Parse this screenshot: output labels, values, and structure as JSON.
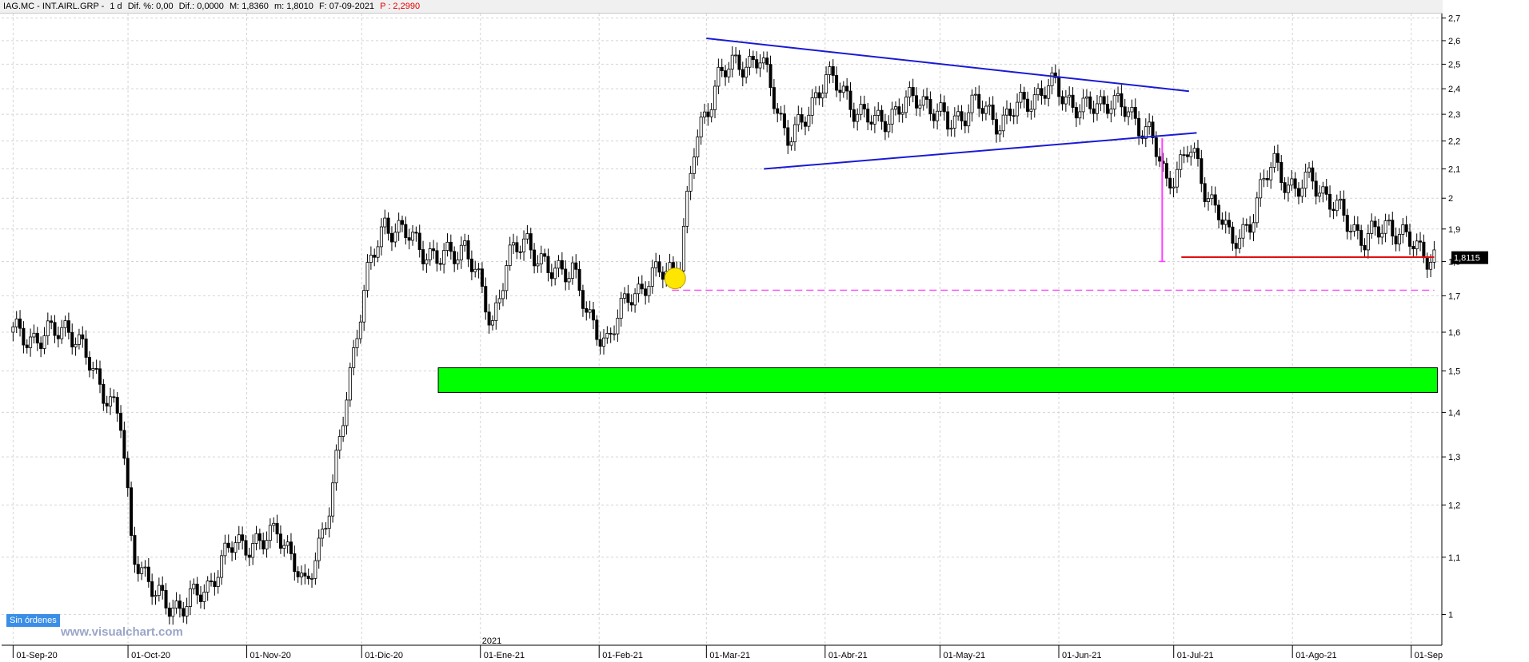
{
  "header": {
    "symbol": "IAG.MC - INT.AIRL.GRP -",
    "period": "1 d",
    "dif_pct": "Dif. %: 0,00",
    "dif": "Dif.: 0,0000",
    "max": "M: 1,8360",
    "min": "m: 1,8010",
    "date": "F: 07-09-2021",
    "p_value": "P : 2,2990"
  },
  "orders_badge": "Sin órdenes",
  "watermark": "www.visualchart.com",
  "colors": {
    "trendline": "#1a1ad4",
    "support": "#e01010",
    "zone": "#00ff00",
    "dashed": "#ff40ff",
    "marker": "#ffe600",
    "last_price_bg": "#000000"
  },
  "chart_data": {
    "type": "candlestick",
    "scale": "log",
    "ylim": [
      0.95,
      2.72
    ],
    "y_ticks": [
      "2,7",
      "2,6",
      "2,5",
      "2,4",
      "2,3",
      "2,2",
      "2,1",
      "2",
      "1,9",
      "1,8",
      "1,7",
      "1,6",
      "1,5",
      "1,4",
      "1,3",
      "1,2",
      "1,1",
      "1"
    ],
    "x_ticks": [
      "01-Sep-20",
      "01-Oct-20",
      "01-Nov-20",
      "01-Dic-20",
      "01-Ene-21",
      "01-Feb-21",
      "01-Mar-21",
      "01-Abr-21",
      "01-May-21",
      "01-Jun-21",
      "01-Jul-21",
      "01-Ago-21",
      "01-Sep"
    ],
    "year_label": "2021",
    "last_price": "1,8115",
    "close_path": [
      [
        "2020-09-01",
        1.6
      ],
      [
        "2020-09-08",
        1.58
      ],
      [
        "2020-09-15",
        1.62
      ],
      [
        "2020-09-22",
        1.5
      ],
      [
        "2020-09-29",
        1.38
      ],
      [
        "2020-10-02",
        1.12
      ],
      [
        "2020-10-08",
        1.03
      ],
      [
        "2020-10-15",
        1.01
      ],
      [
        "2020-10-22",
        1.05
      ],
      [
        "2020-10-29",
        1.13
      ],
      [
        "2020-11-05",
        1.12
      ],
      [
        "2020-11-09",
        1.16
      ],
      [
        "2020-11-16",
        1.04
      ],
      [
        "2020-11-23",
        1.2
      ],
      [
        "2020-11-30",
        1.62
      ],
      [
        "2020-12-03",
        1.78
      ],
      [
        "2020-12-07",
        1.92
      ],
      [
        "2020-12-14",
        1.87
      ],
      [
        "2020-12-21",
        1.8
      ],
      [
        "2020-12-28",
        1.85
      ],
      [
        "2021-01-04",
        1.62
      ],
      [
        "2021-01-08",
        1.8
      ],
      [
        "2021-01-13",
        1.87
      ],
      [
        "2021-01-19",
        1.76
      ],
      [
        "2021-01-25",
        1.79
      ],
      [
        "2021-01-29",
        1.63
      ],
      [
        "2021-02-03",
        1.58
      ],
      [
        "2021-02-09",
        1.7
      ],
      [
        "2021-02-16",
        1.76
      ],
      [
        "2021-02-22",
        1.79
      ],
      [
        "2021-02-26",
        2.18
      ],
      [
        "2021-03-04",
        2.45
      ],
      [
        "2021-03-09",
        2.5
      ],
      [
        "2021-03-15",
        2.52
      ],
      [
        "2021-03-22",
        2.22
      ],
      [
        "2021-03-26",
        2.25
      ],
      [
        "2021-04-01",
        2.46
      ],
      [
        "2021-04-08",
        2.34
      ],
      [
        "2021-04-14",
        2.26
      ],
      [
        "2021-04-20",
        2.32
      ],
      [
        "2021-04-26",
        2.37
      ],
      [
        "2021-05-03",
        2.26
      ],
      [
        "2021-05-10",
        2.34
      ],
      [
        "2021-05-17",
        2.27
      ],
      [
        "2021-05-24",
        2.36
      ],
      [
        "2021-05-31",
        2.41
      ],
      [
        "2021-06-07",
        2.31
      ],
      [
        "2021-06-14",
        2.36
      ],
      [
        "2021-06-21",
        2.28
      ],
      [
        "2021-06-25",
        2.23
      ],
      [
        "2021-06-29",
        2.04
      ],
      [
        "2021-07-05",
        2.18
      ],
      [
        "2021-07-09",
        2.03
      ],
      [
        "2021-07-13",
        1.96
      ],
      [
        "2021-07-16",
        1.84
      ],
      [
        "2021-07-21",
        1.93
      ],
      [
        "2021-07-27",
        2.13
      ],
      [
        "2021-08-02",
        2.01
      ],
      [
        "2021-08-06",
        2.08
      ],
      [
        "2021-08-11",
        1.98
      ],
      [
        "2021-08-16",
        1.92
      ],
      [
        "2021-08-20",
        1.86
      ],
      [
        "2021-08-26",
        1.92
      ],
      [
        "2021-08-31",
        1.86
      ],
      [
        "2021-09-07",
        1.8115
      ]
    ],
    "annotations": {
      "triangle_upper": [
        [
          "2021-03-01",
          2.61
        ],
        [
          "2021-07-05",
          2.39
        ]
      ],
      "triangle_lower": [
        [
          "2021-03-16",
          2.1
        ],
        [
          "2021-07-07",
          2.23
        ]
      ],
      "support_line": [
        [
          "2021-07-03",
          1.813
        ],
        [
          "2021-09-07",
          1.813
        ]
      ],
      "dashed_level": [
        [
          "2021-02-20",
          1.716
        ],
        [
          "2021-09-07",
          1.716
        ]
      ],
      "green_zone": {
        "from": "2020-12-21",
        "to": "2021-09-07",
        "low": 1.447,
        "high": 1.508
      },
      "vertical_marker": {
        "date": "2021-06-28",
        "low": 1.8,
        "high": 2.21
      },
      "circle_marker": {
        "date": "2021-02-20",
        "value": 1.75
      }
    }
  }
}
